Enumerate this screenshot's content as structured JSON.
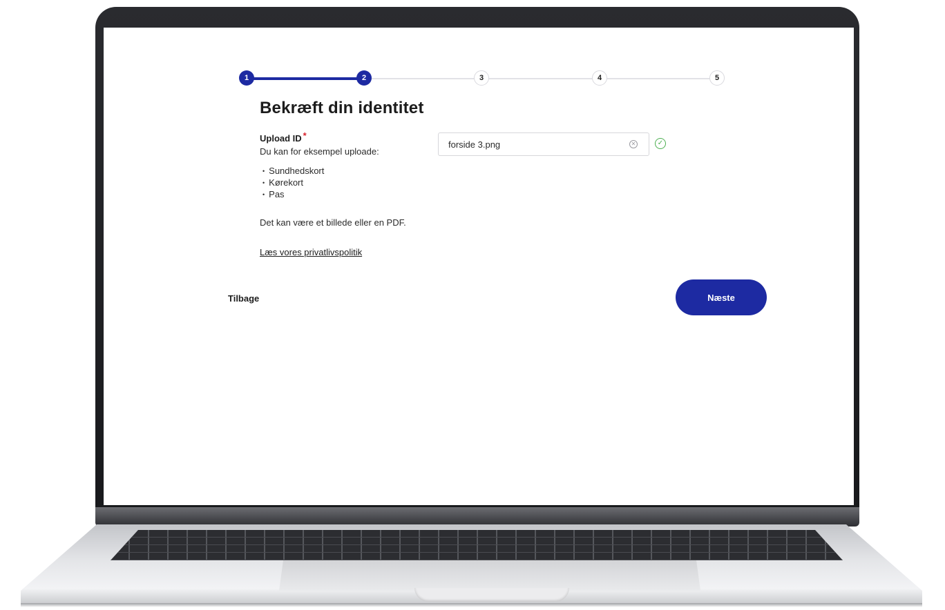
{
  "stepper": {
    "steps": [
      "1",
      "2",
      "3",
      "4",
      "5"
    ],
    "current_step": 2,
    "active_color": "#1d2aa2"
  },
  "form": {
    "title": "Bekræft din identitet",
    "upload_label": "Upload ID",
    "required_marker": "*",
    "hint": "Du kan for eksempel uploade:",
    "examples": [
      "Sundhedskort",
      "Kørekort",
      "Pas"
    ],
    "note": "Det kan være et billede eller en PDF.",
    "privacy_link": "Læs vores privatlivspolitik",
    "uploaded_file": "forside 3.png",
    "clear_icon": "close-circle-icon",
    "status_icon": "check-circle-icon"
  },
  "nav": {
    "back_label": "Tilbage",
    "next_label": "Næste"
  }
}
